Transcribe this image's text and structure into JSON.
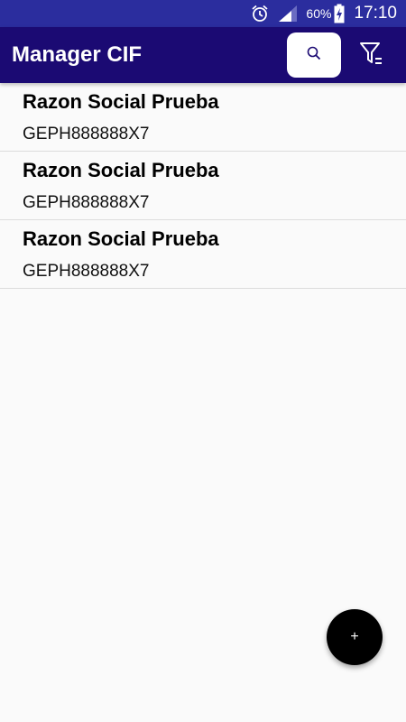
{
  "status_bar": {
    "battery_percent": "60%",
    "time": "17:10",
    "icons": [
      "alarm-icon",
      "signal-icon",
      "battery-charging-icon"
    ]
  },
  "app_bar": {
    "title": "Manager CIF",
    "actions": [
      {
        "name": "search",
        "icon": "search-icon"
      },
      {
        "name": "filter",
        "icon": "filter-icon"
      }
    ]
  },
  "list": {
    "items": [
      {
        "title": "Razon Social Prueba",
        "subtitle": "GEPH888888X7"
      },
      {
        "title": "Razon Social Prueba",
        "subtitle": "GEPH888888X7"
      },
      {
        "title": "Razon Social Prueba",
        "subtitle": "GEPH888888X7"
      }
    ]
  },
  "fab": {
    "label": "+"
  },
  "colors": {
    "status_bar": "#2b2d9e",
    "app_bar": "#1b0a73",
    "background": "#fafafa",
    "fab": "#000000"
  }
}
